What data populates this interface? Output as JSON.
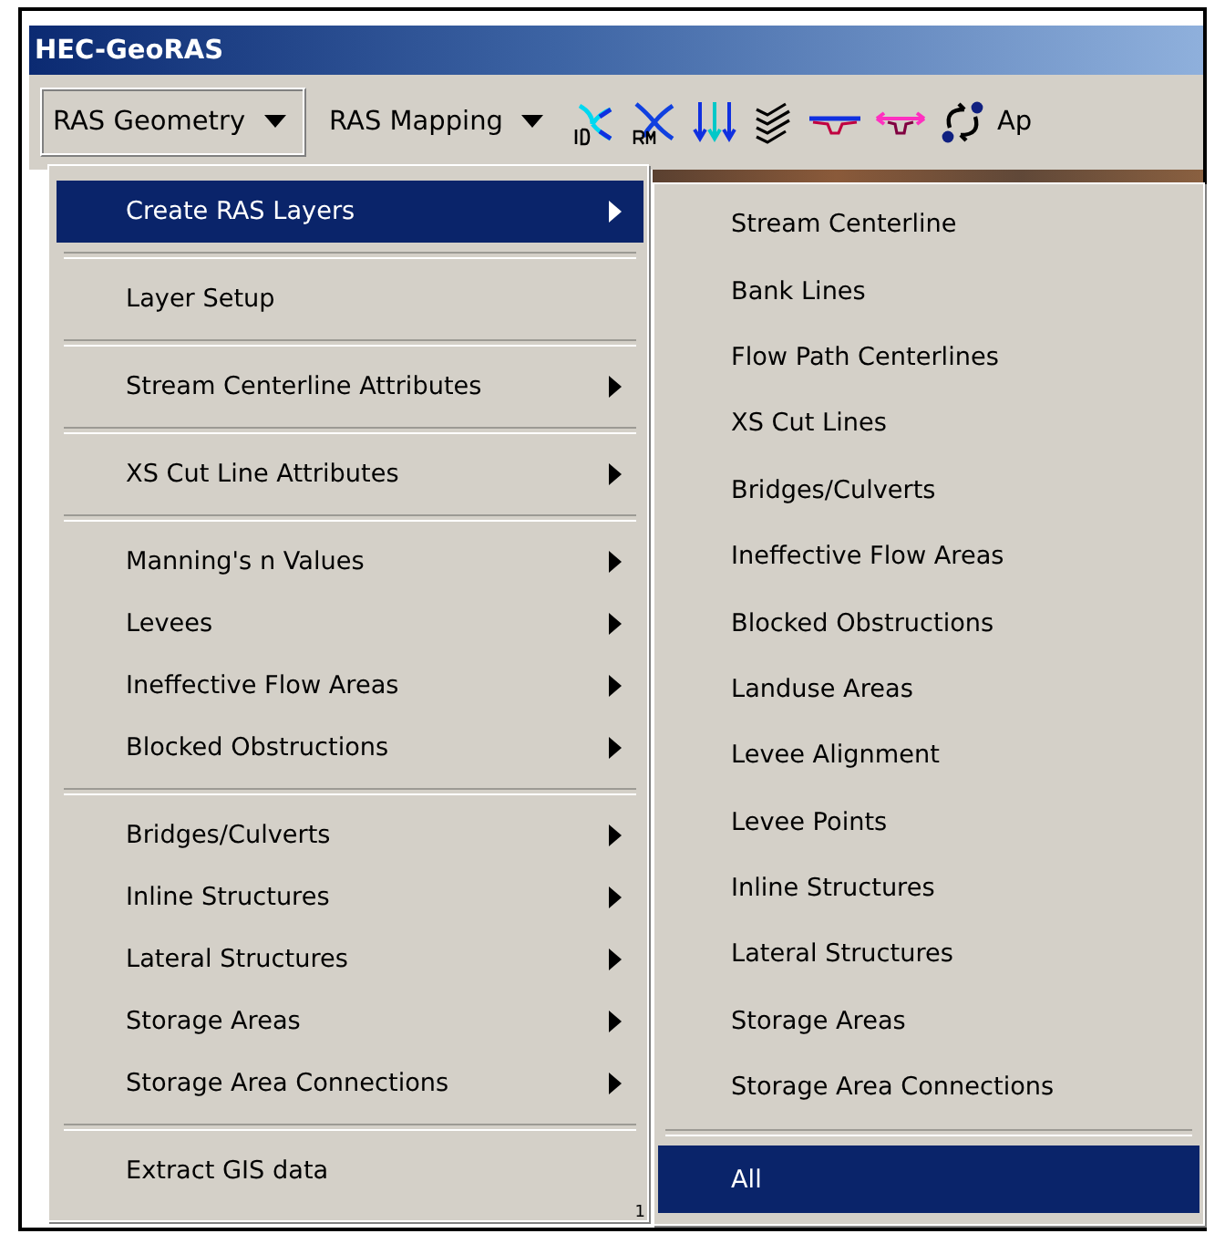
{
  "window": {
    "title": "HEC-GeoRAS"
  },
  "toolbar": {
    "menus": [
      {
        "label": "RAS Geometry",
        "selected": true
      },
      {
        "label": "RAS Mapping",
        "selected": false
      }
    ],
    "cut_label": "Ap"
  },
  "menu": {
    "items": [
      {
        "kind": "item",
        "label": "Create RAS Layers",
        "submenu": true,
        "selected": true
      },
      {
        "kind": "separator"
      },
      {
        "kind": "item",
        "label": "Layer Setup",
        "submenu": false,
        "selected": false
      },
      {
        "kind": "separator"
      },
      {
        "kind": "item",
        "label": "Stream Centerline Attributes",
        "submenu": true,
        "selected": false
      },
      {
        "kind": "separator"
      },
      {
        "kind": "item",
        "label": "XS Cut Line Attributes",
        "submenu": true,
        "selected": false
      },
      {
        "kind": "separator"
      },
      {
        "kind": "item",
        "label": "Manning's n Values",
        "submenu": true,
        "selected": false
      },
      {
        "kind": "item",
        "label": "Levees",
        "submenu": true,
        "selected": false
      },
      {
        "kind": "item",
        "label": "Ineffective Flow Areas",
        "submenu": true,
        "selected": false
      },
      {
        "kind": "item",
        "label": "Blocked Obstructions",
        "submenu": true,
        "selected": false
      },
      {
        "kind": "separator"
      },
      {
        "kind": "item",
        "label": "Bridges/Culverts",
        "submenu": true,
        "selected": false
      },
      {
        "kind": "item",
        "label": "Inline Structures",
        "submenu": true,
        "selected": false
      },
      {
        "kind": "item",
        "label": "Lateral Structures",
        "submenu": true,
        "selected": false
      },
      {
        "kind": "item",
        "label": "Storage Areas",
        "submenu": true,
        "selected": false
      },
      {
        "kind": "item",
        "label": "Storage Area Connections",
        "submenu": true,
        "selected": false
      },
      {
        "kind": "separator"
      },
      {
        "kind": "item",
        "label": "Extract GIS data",
        "submenu": false,
        "selected": false
      }
    ],
    "corner_mark": "1"
  },
  "submenu": {
    "items": [
      {
        "kind": "item",
        "label": "Stream Centerline",
        "selected": false
      },
      {
        "kind": "item",
        "label": "Bank Lines",
        "selected": false
      },
      {
        "kind": "item",
        "label": "Flow Path Centerlines",
        "selected": false
      },
      {
        "kind": "item",
        "label": "XS Cut Lines",
        "selected": false
      },
      {
        "kind": "item",
        "label": "Bridges/Culverts",
        "selected": false
      },
      {
        "kind": "item",
        "label": "Ineffective Flow Areas",
        "selected": false
      },
      {
        "kind": "item",
        "label": "Blocked Obstructions",
        "selected": false
      },
      {
        "kind": "item",
        "label": "Landuse Areas",
        "selected": false
      },
      {
        "kind": "item",
        "label": "Levee Alignment",
        "selected": false
      },
      {
        "kind": "item",
        "label": "Levee Points",
        "selected": false
      },
      {
        "kind": "item",
        "label": "Inline Structures",
        "selected": false
      },
      {
        "kind": "item",
        "label": "Lateral Structures",
        "selected": false
      },
      {
        "kind": "item",
        "label": "Storage Areas",
        "selected": false
      },
      {
        "kind": "item",
        "label": "Storage Area Connections",
        "selected": false
      },
      {
        "kind": "separator"
      },
      {
        "kind": "item",
        "label": "All",
        "selected": true
      }
    ]
  }
}
